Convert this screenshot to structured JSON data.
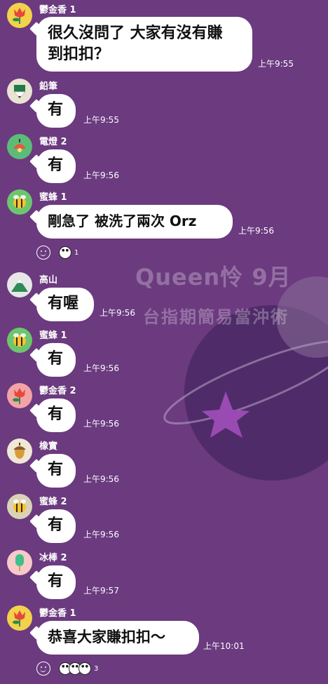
{
  "wallpaper": {
    "title": "Queen怜  9月",
    "subtitle": "台指期簡易當沖術"
  },
  "messages": [
    {
      "sender": "鬱金香 1",
      "avatar": "tulip-avatar",
      "avatar_color": "#f2d24b",
      "lines": [
        "很久沒問了 大家有沒有賺",
        "到扣扣？"
      ],
      "time": "上午9:55"
    },
    {
      "sender": "鉛筆",
      "avatar": "pencil-avatar",
      "avatar_color": "#e9e3d4",
      "lines": [
        "有"
      ],
      "time": "上午9:55"
    },
    {
      "sender": "電燈 2",
      "avatar": "lamp-avatar",
      "avatar_color": "#5dbb78",
      "lines": [
        "有"
      ],
      "time": "上午9:56"
    },
    {
      "sender": "蜜蜂 1",
      "avatar": "bee-avatar",
      "avatar_color": "#6cc66e",
      "lines": [
        "剛急了 被洗了兩次 Orz"
      ],
      "time": "上午9:56",
      "reaction_count": "1"
    },
    {
      "sender": "高山",
      "avatar": "mountain-avatar",
      "avatar_color": "#e7e7e7",
      "lines": [
        "有喔"
      ],
      "time": "上午9:56"
    },
    {
      "sender": "蜜蜂 1",
      "avatar": "bee-avatar",
      "avatar_color": "#6cc66e",
      "lines": [
        "有"
      ],
      "time": "上午9:56"
    },
    {
      "sender": "鬱金香 2",
      "avatar": "tulip-avatar",
      "avatar_color": "#f2a3a6",
      "lines": [
        "有"
      ],
      "time": "上午9:56"
    },
    {
      "sender": "橡實",
      "avatar": "acorn-avatar",
      "avatar_color": "#f0e8d6",
      "lines": [
        "有"
      ],
      "time": "上午9:56"
    },
    {
      "sender": "蜜蜂 2",
      "avatar": "bee-avatar",
      "avatar_color": "#d9d2b8",
      "lines": [
        "有"
      ],
      "time": "上午9:56"
    },
    {
      "sender": "冰棒 2",
      "avatar": "popsicle-avatar",
      "avatar_color": "#f7c9c9",
      "lines": [
        "有"
      ],
      "time": "上午9:57"
    },
    {
      "sender": "鬱金香 1",
      "avatar": "tulip-avatar",
      "avatar_color": "#f2d24b",
      "lines": [
        "恭喜大家賺扣扣～"
      ],
      "time": "上午10:01",
      "reaction_count": "3"
    }
  ]
}
